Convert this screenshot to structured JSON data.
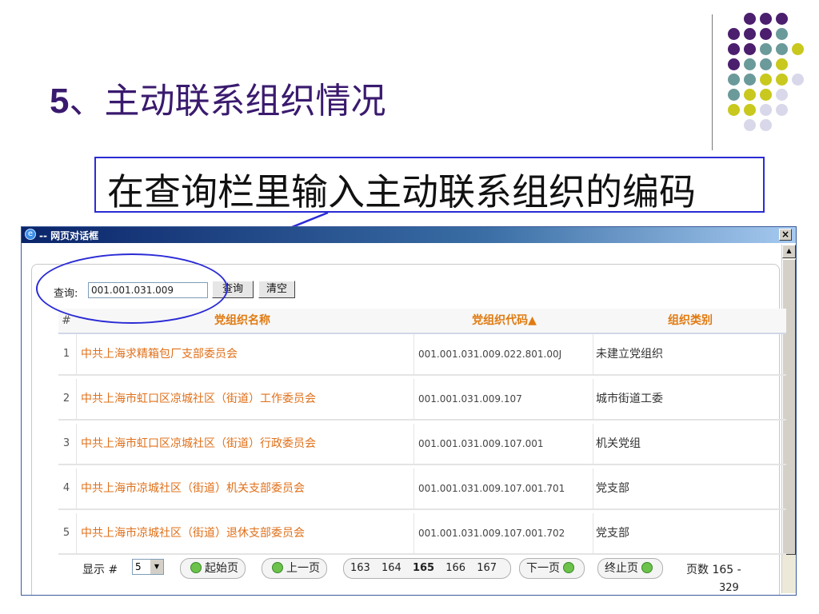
{
  "slide": {
    "number": "5",
    "title_rest": "、主动联系组织情况",
    "callout": "在查询栏里输入主动联系组织的编码"
  },
  "colors": {
    "dot_purple": "#4b1e6e",
    "dot_teal": "#6b9a9a",
    "dot_yellow": "#c8c81e",
    "dot_lavender": "#d8d8ea",
    "accent_orange": "#e07a10",
    "callout_blue": "#2b2bd6"
  },
  "dialog": {
    "title": "-- 网页对话框",
    "close_icon": "close-icon",
    "search": {
      "label": "查询:",
      "value": "001.001.031.009",
      "query_button": "查询",
      "clear_button": "清空"
    },
    "table": {
      "headers": [
        "#",
        "党组织名称",
        "党组织代码▲",
        "组织类别"
      ],
      "rows": [
        {
          "num": "1",
          "name": "中共上海求精箱包厂支部委员会",
          "code": "001.001.031.009.022.801.00J",
          "type": "未建立党组织"
        },
        {
          "num": "2",
          "name": "中共上海市虹口区凉城社区（街道）工作委员会",
          "code": "001.001.031.009.107",
          "type": "城市街道工委"
        },
        {
          "num": "3",
          "name": "中共上海市虹口区凉城社区（街道）行政委员会",
          "code": "001.001.031.009.107.001",
          "type": "机关党组"
        },
        {
          "num": "4",
          "name": "中共上海市凉城社区（街道）机关支部委员会",
          "code": "001.001.031.009.107.001.701",
          "type": "党支部"
        },
        {
          "num": "5",
          "name": "中共上海市凉城社区（街道）退休支部委员会",
          "code": "001.001.031.009.107.001.702",
          "type": "党支部"
        }
      ]
    },
    "pager": {
      "show_label": "显示 #",
      "page_size": "5",
      "first": "起始页",
      "prev": "上一页",
      "pages": [
        "163",
        "164",
        "165",
        "166",
        "167"
      ],
      "current": "165",
      "next": "下一页",
      "last": "终止页",
      "page_count_label": "页数 165 -",
      "page_count_total": "329"
    }
  }
}
